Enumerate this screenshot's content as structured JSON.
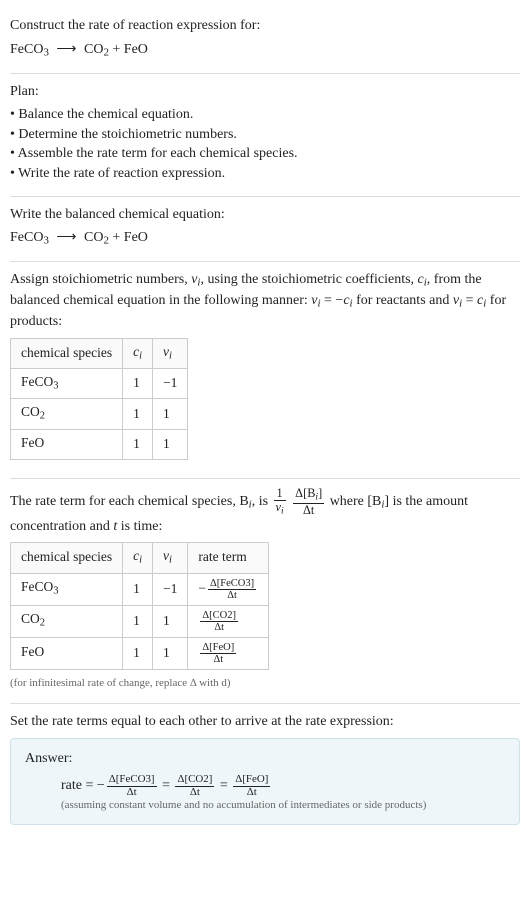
{
  "intro": {
    "line1": "Construct the rate of reaction expression for:",
    "eq_lhs": "FeCO",
    "eq_lhs_sub": "3",
    "arrow": "⟶",
    "eq_r1": "CO",
    "eq_r1_sub": "2",
    "plus": "+",
    "eq_r2": "FeO"
  },
  "plan": {
    "heading": "Plan:",
    "items": [
      "Balance the chemical equation.",
      "Determine the stoichiometric numbers.",
      "Assemble the rate term for each chemical species.",
      "Write the rate of reaction expression."
    ]
  },
  "balanced": {
    "heading": "Write the balanced chemical equation:",
    "eq_lhs": "FeCO",
    "eq_lhs_sub": "3",
    "arrow": "⟶",
    "eq_r1": "CO",
    "eq_r1_sub": "2",
    "plus": "+",
    "eq_r2": "FeO"
  },
  "stoich": {
    "text_a": "Assign stoichiometric numbers, ",
    "nu_i": "ν",
    "nu_i_sub": "i",
    "text_b": ", using the stoichiometric coefficients, ",
    "c_i": "c",
    "c_i_sub": "i",
    "text_c": ", from the balanced chemical equation in the following manner: ",
    "rel1_lhs": "ν",
    "rel1_lhs_sub": "i",
    "rel1_eq": " = −",
    "rel1_rhs": "c",
    "rel1_rhs_sub": "i",
    "text_d": " for reactants and ",
    "rel2_lhs": "ν",
    "rel2_lhs_sub": "i",
    "rel2_eq": " = ",
    "rel2_rhs": "c",
    "rel2_rhs_sub": "i",
    "text_e": " for products:",
    "headers": {
      "species": "chemical species",
      "ci": "c",
      "ci_sub": "i",
      "nui": "ν",
      "nui_sub": "i"
    },
    "rows": [
      {
        "name": "FeCO",
        "name_sub": "3",
        "ci": "1",
        "nui": "−1"
      },
      {
        "name": "CO",
        "name_sub": "2",
        "ci": "1",
        "nui": "1"
      },
      {
        "name": "FeO",
        "name_sub": "",
        "ci": "1",
        "nui": "1"
      }
    ]
  },
  "rateterm": {
    "text_a": "The rate term for each chemical species, B",
    "Bi_sub": "i",
    "text_b": ", is ",
    "one": "1",
    "nu": "ν",
    "nu_sub": "i",
    "dconc_num": "Δ[B",
    "dconc_num_sub": "i",
    "dconc_num_close": "]",
    "dconc_den": "Δt",
    "text_c": " where [B",
    "text_c_sub": "i",
    "text_d": "] is the amount concentration and ",
    "t": "t",
    "text_e": " is time:",
    "headers": {
      "species": "chemical species",
      "ci": "c",
      "ci_sub": "i",
      "nui": "ν",
      "nui_sub": "i",
      "rate": "rate term"
    },
    "rows": [
      {
        "name": "FeCO",
        "name_sub": "3",
        "ci": "1",
        "nui": "−1",
        "sign": "−",
        "conc": "Δ[FeCO3]",
        "den": "Δt"
      },
      {
        "name": "CO",
        "name_sub": "2",
        "ci": "1",
        "nui": "1",
        "sign": "",
        "conc": "Δ[CO2]",
        "den": "Δt"
      },
      {
        "name": "FeO",
        "name_sub": "",
        "ci": "1",
        "nui": "1",
        "sign": "",
        "conc": "Δ[FeO]",
        "den": "Δt"
      }
    ],
    "footnote": "(for infinitesimal rate of change, replace Δ with d)"
  },
  "final": {
    "heading": "Set the rate terms equal to each other to arrive at the rate expression:",
    "answer_label": "Answer:",
    "rate_word": "rate = ",
    "neg": "−",
    "t1_num": "Δ[FeCO3]",
    "t1_den": "Δt",
    "eq1": " = ",
    "t2_num": "Δ[CO2]",
    "t2_den": "Δt",
    "eq2": " = ",
    "t3_num": "Δ[FeO]",
    "t3_den": "Δt",
    "note": "(assuming constant volume and no accumulation of intermediates or side products)"
  }
}
